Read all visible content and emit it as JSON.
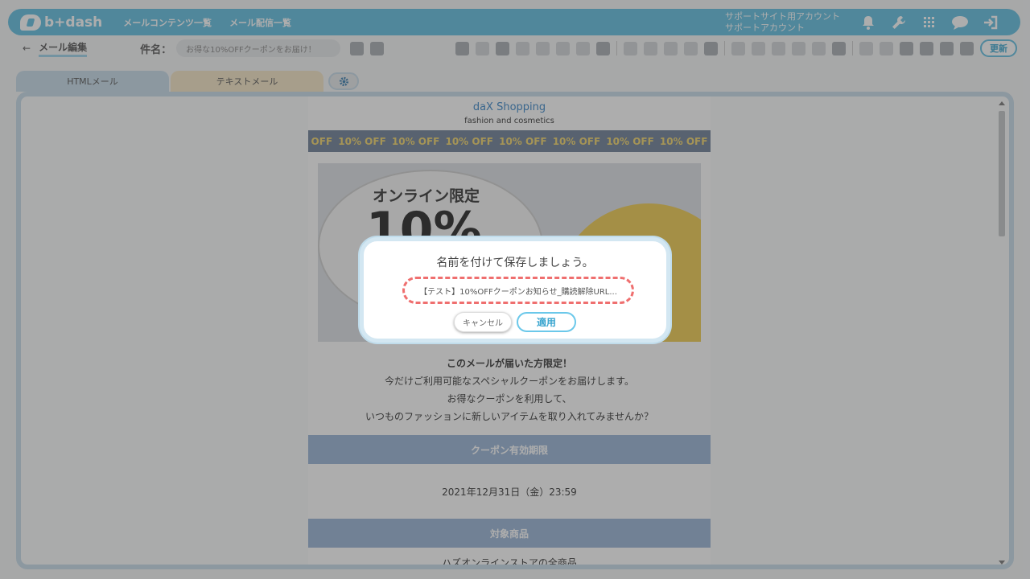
{
  "header": {
    "logo_text": "b+dash",
    "nav": [
      "メールコンテンツ一覧",
      "メール配信一覧"
    ],
    "account_line1": "サポートサイト用アカウント",
    "account_line2": "サポートアカウント",
    "icons": [
      "bell-icon",
      "wrench-icon",
      "grid-icon",
      "chat-icon",
      "logout-icon"
    ]
  },
  "toolbar": {
    "back_label": "メール編集",
    "subject_label": "件名：",
    "subject_value": "お得な10%OFFクーポンをお届け！",
    "update_label": "更新"
  },
  "tabs": {
    "html": "HTMLメール",
    "text": "テキストメール"
  },
  "email": {
    "shop_name": "daX Shopping",
    "shop_sub": "fashion and cosmetics",
    "banner": [
      "OFF",
      "10% OFF",
      "10% OFF",
      "10% OFF",
      "10% OFF",
      "10% OFF",
      "10% OFF",
      "10% OFF"
    ],
    "hero_title": "オンライン限定",
    "hero_pct": "10%",
    "lines": [
      "このメールが届いた方限定！",
      "今だけご利用可能なスペシャルクーポンをお届けします。",
      "お得なクーポンを利用して、",
      "いつものファッションに新しいアイテムを取り入れてみませんか？"
    ],
    "section1_title": "クーポン有効期限",
    "section1_body": "2021年12月31日（金）23:59",
    "section2_title": "対象商品",
    "section2_body_partial": "ハズオンラインストアの全商品"
  },
  "modal": {
    "title": "名前を付けて保存しましょう。",
    "input_value": "【テスト】10%OFFクーポンお知らせ_購読解除URL...",
    "cancel_label": "キャンセル",
    "apply_label": "適用"
  },
  "colors": {
    "accent": "#5fbde0",
    "highlight": "#ef6f6f"
  }
}
